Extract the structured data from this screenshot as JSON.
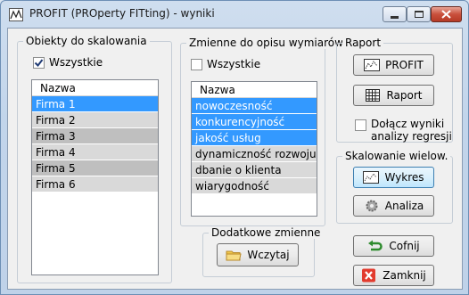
{
  "window": {
    "title": "PROFIT (PROperty FITting) - wyniki"
  },
  "objects_panel": {
    "title": "Obiekty do skalowania",
    "all_label": "Wszystkie",
    "all_checked": true,
    "header": "Nazwa",
    "items": [
      "Firma 1",
      "Firma 2",
      "Firma 3",
      "Firma 4",
      "Firma 5",
      "Firma 6"
    ]
  },
  "variables_panel": {
    "title": "Zmienne do opisu wymiarów",
    "all_label": "Wszystkie",
    "all_checked": false,
    "header": "Nazwa",
    "items": [
      "nowoczesność",
      "konkurencyjność",
      "jakość usług",
      "dynamiczność rozwoju",
      "dbanie o klienta",
      "wiarygodność"
    ]
  },
  "extra_vars": {
    "title": "Dodatkowe zmienne",
    "load_label": "Wczytaj"
  },
  "report_panel": {
    "title": "Raport",
    "profit_label": "PROFIT",
    "report_label": "Raport",
    "attach_label_line1": "Dołącz wyniki",
    "attach_label_line2": "analizy regresji",
    "attach_checked": false
  },
  "scaling_panel": {
    "title": "Skalowanie wielow.",
    "chart_label": "Wykres",
    "analysis_label": "Analiza"
  },
  "actions": {
    "undo_label": "Cofnij",
    "close_label": "Zamknij"
  },
  "colors": {
    "selection": "#3399ff",
    "row_light": "#d9d9d9",
    "row_dark": "#bfbfbf"
  }
}
